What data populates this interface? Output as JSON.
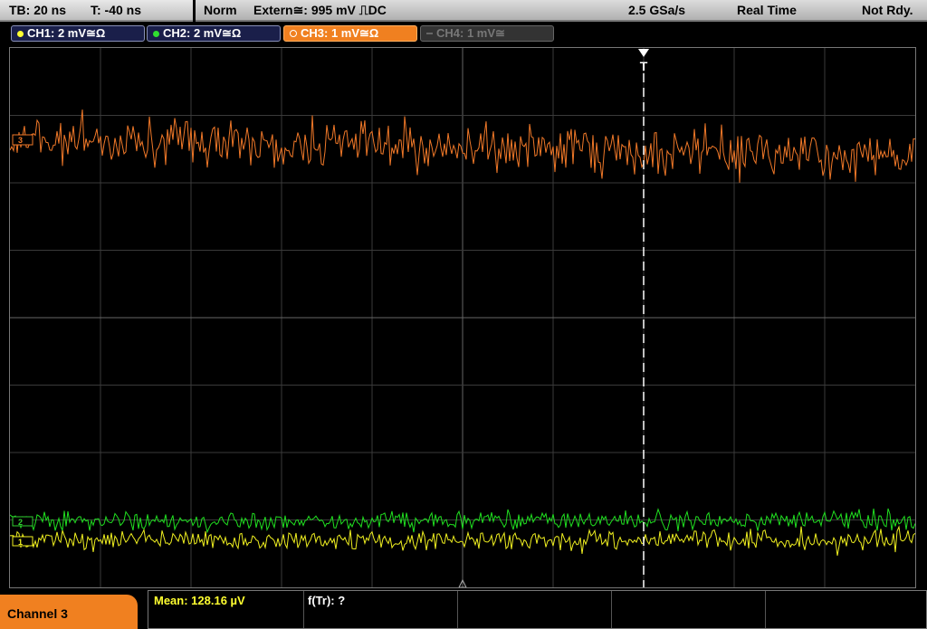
{
  "topbar": {
    "timebase": "TB: 20 ns",
    "trigger_time": "T: -40 ns",
    "mode": "Norm",
    "trigger": "Extern≅: 995 mV ⎍DC",
    "sample_rate": "2.5 GSa/s",
    "acq_mode": "Real Time",
    "status": "Not Rdy."
  },
  "channels": [
    {
      "label": "CH1: 2 mV≅Ω",
      "color": "#ffff30"
    },
    {
      "label": "CH2: 2 mV≅Ω",
      "color": "#30e030"
    },
    {
      "label": "CH3: 1 mV≅Ω",
      "color": "#ffa050"
    },
    {
      "label": "CH4: 1 mV≅",
      "color": "#666666"
    }
  ],
  "markers": {
    "ch3": "3",
    "ch2": "2",
    "ch1": "1",
    "trigger": "T"
  },
  "trace_colors": {
    "ch1": "#f0f020",
    "ch2": "#20e020",
    "ch3": "#f07828"
  },
  "bottom": {
    "tab_label": "Channel 3",
    "mean": "Mean: 128.16 µV",
    "freq": "f(Tr): ?"
  }
}
